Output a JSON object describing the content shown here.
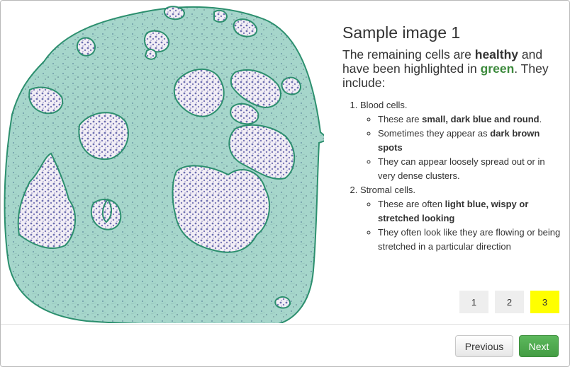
{
  "title": "Sample image 1",
  "intro": {
    "part1": "The remaining cells are ",
    "healthy": "healthy",
    "part2": " and have been highlighted in ",
    "green": "green",
    "part3": ". They include:"
  },
  "cell_types": [
    {
      "name": "Blood cells.",
      "bullets": [
        {
          "pre": "These are ",
          "bold": "small, dark blue and round",
          "post": "."
        },
        {
          "pre": "Sometimes they appear as ",
          "bold": "dark brown spots",
          "post": ""
        },
        {
          "pre": "They can appear loosely spread out or in very dense clusters.",
          "bold": "",
          "post": ""
        }
      ]
    },
    {
      "name": "Stromal cells.",
      "bullets": [
        {
          "pre": "These are often ",
          "bold": "light blue, wispy or stretched looking",
          "post": ""
        },
        {
          "pre": "They often look like they are flowing or being stretched in a particular direction",
          "bold": "",
          "post": ""
        }
      ]
    }
  ],
  "pagination": {
    "pages": [
      "1",
      "2",
      "3"
    ],
    "active_page": "3",
    "active_color": "#ffff00"
  },
  "footer": {
    "previous_label": "Previous",
    "next_label": "Next"
  },
  "colors": {
    "overlay_fill": "#a9d8ce",
    "overlay_border": "#2c8f6e",
    "next_button": "#5cb85c"
  }
}
